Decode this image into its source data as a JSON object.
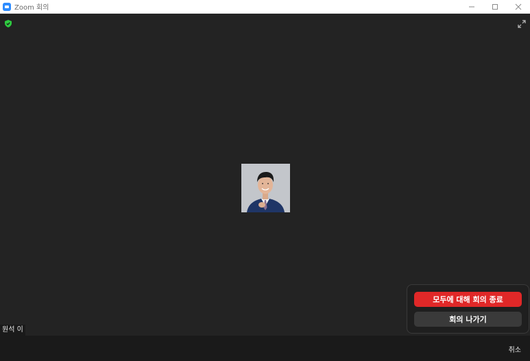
{
  "window": {
    "title": "Zoom 회의"
  },
  "participant": {
    "name": "원석 이"
  },
  "leave_popup": {
    "end_for_all_label": "모두에 대해 회의 종료",
    "leave_label": "회의 나가기"
  },
  "toolbar": {
    "cancel_label": "취소"
  },
  "colors": {
    "end_button": "#e02828",
    "leave_button": "#3a3a3a",
    "shield": "#2ecc40",
    "background": "#232323"
  },
  "icons": {
    "app": "zoom-app-icon",
    "security": "shield-check-icon",
    "fullscreen": "expand-icon"
  }
}
